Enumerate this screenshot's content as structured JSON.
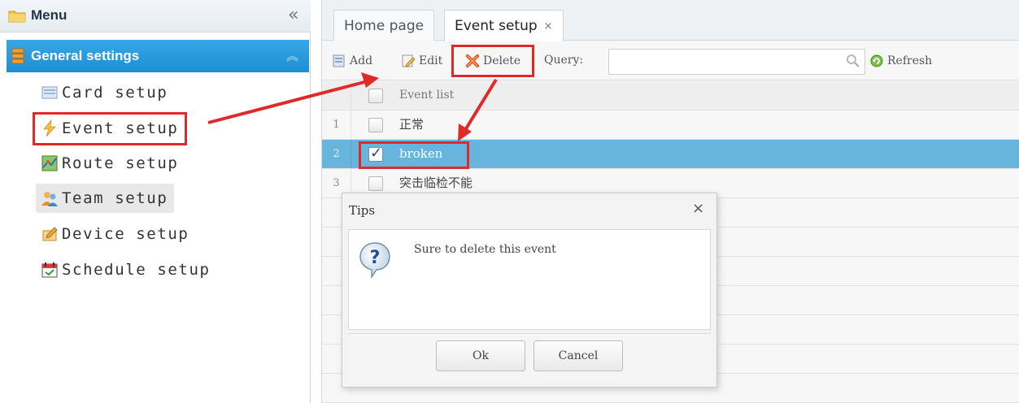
{
  "sidebar": {
    "header_title": "Menu",
    "collapse_glyph": "«",
    "group": {
      "title": "General settings",
      "collapse_glyph": "︽"
    },
    "items": [
      {
        "label": "Card setup",
        "icon": "card-icon"
      },
      {
        "label": "Event setup",
        "icon": "lightning-icon"
      },
      {
        "label": "Route setup",
        "icon": "map-icon"
      },
      {
        "label": "Team setup",
        "icon": "team-icon"
      },
      {
        "label": "Device setup",
        "icon": "device-icon"
      },
      {
        "label": "Schedule setup",
        "icon": "calendar-icon"
      }
    ]
  },
  "tabs": [
    {
      "label": "Home page"
    },
    {
      "label": "Event setup",
      "close_glyph": "×"
    }
  ],
  "toolbar": {
    "add_label": "Add",
    "edit_label": "Edit",
    "delete_label": "Delete",
    "query_label": "Query:",
    "query_value": "",
    "refresh_label": "Refresh"
  },
  "grid": {
    "column_header": "Event list",
    "rows": [
      {
        "num": "1",
        "name": "正常",
        "checked": false
      },
      {
        "num": "2",
        "name": "broken",
        "checked": true
      },
      {
        "num": "3",
        "name": "突击临检不能",
        "checked": false
      }
    ]
  },
  "dialog": {
    "title": "Tips",
    "close_glyph": "×",
    "message": "Sure to delete this event",
    "ok_label": "Ok",
    "cancel_label": "Cancel"
  },
  "colors": {
    "accent": "#1c8ed2",
    "selected_row": "#67b4dc",
    "annotation_red": "#e02a2a"
  }
}
